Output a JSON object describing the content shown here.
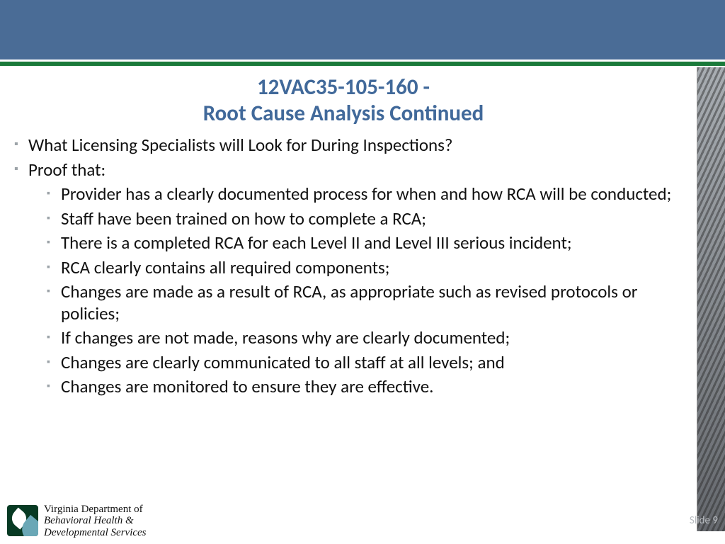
{
  "title": {
    "line1": "12VAC35-105-160  -",
    "line2": "Root Cause Analysis Continued"
  },
  "bullets_lvl1": [
    "What Licensing Specialists will Look for During Inspections?",
    "Proof that:"
  ],
  "bullets_lvl2": [
    "Provider has a clearly documented process for when and how RCA will be conducted;",
    "Staff have been trained on how to complete a RCA;",
    "There is a completed RCA for each Level II and Level III serious incident;",
    "RCA clearly contains all required components;",
    "Changes are made as a result of RCA, as appropriate such as revised protocols or policies;",
    "If changes are not made, reasons why are clearly documented;",
    "Changes are clearly communicated to all staff at all levels; and",
    "Changes are monitored to ensure they are effective."
  ],
  "footer": {
    "logo_line1": "Virginia Department of",
    "logo_line2": "Behavioral Health &",
    "logo_line3": "Developmental Services",
    "slide_label": "Slide 9"
  }
}
